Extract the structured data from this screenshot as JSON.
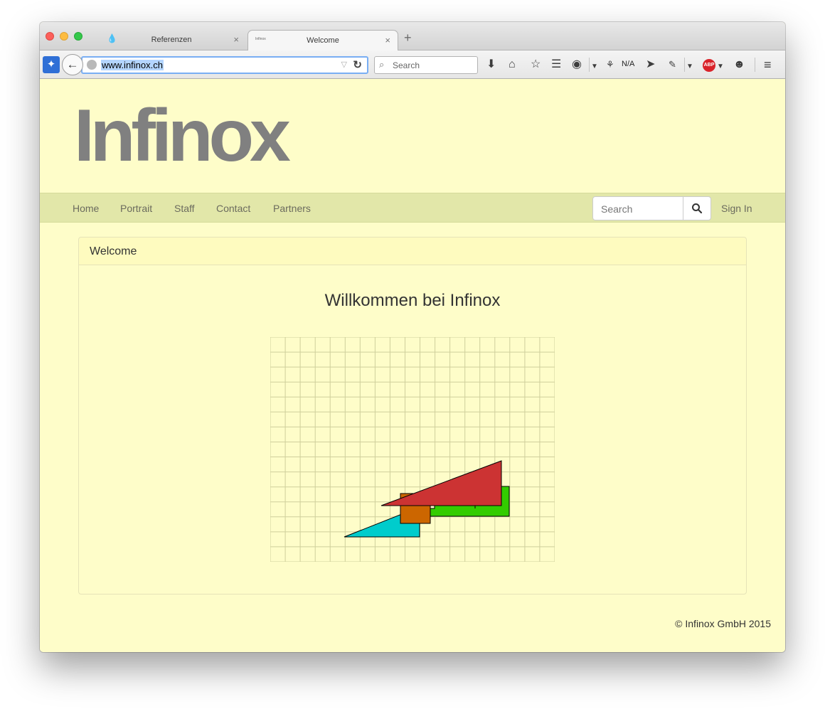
{
  "browser": {
    "tabs": [
      {
        "title": "Referenzen",
        "close": "×",
        "active": false
      },
      {
        "title": "Welcome",
        "favicon_text": "Infinox",
        "close": "×",
        "active": true
      }
    ],
    "new_tab": "+",
    "url": "www.infinox.ch",
    "search_placeholder": "Search",
    "toolbar_status": "N/A",
    "abp_label": "ABP",
    "icons": [
      "extension-compass-icon",
      "back-arrow-icon",
      "globe-icon",
      "reload-icon",
      "search-icon",
      "download-icon",
      "home-icon",
      "bookmark-star-icon",
      "reading-list-icon",
      "earth-extension-icon",
      "graph-extension-icon",
      "send-icon",
      "bug-extension-icon",
      "adblock-icon",
      "smiley-extension-icon",
      "hamburger-menu-icon"
    ]
  },
  "site": {
    "logo": "Infinox",
    "nav": [
      "Home",
      "Portrait",
      "Staff",
      "Contact",
      "Partners"
    ],
    "search_placeholder": "Search",
    "sign_in": "Sign In",
    "panel_title": "Welcome",
    "heading": "Willkommen bei Infinox",
    "footer": "© Infinox GmbH 2015"
  },
  "figure": {
    "grid_cols": 19,
    "grid_rows": 15,
    "colors": {
      "background": "#fefdc9",
      "grid": "#cfcf9c",
      "cyan": "#00cccc",
      "green": "#33cc00",
      "orange": "#cc6600",
      "red": "#cc3333",
      "stroke": "#000000"
    }
  }
}
